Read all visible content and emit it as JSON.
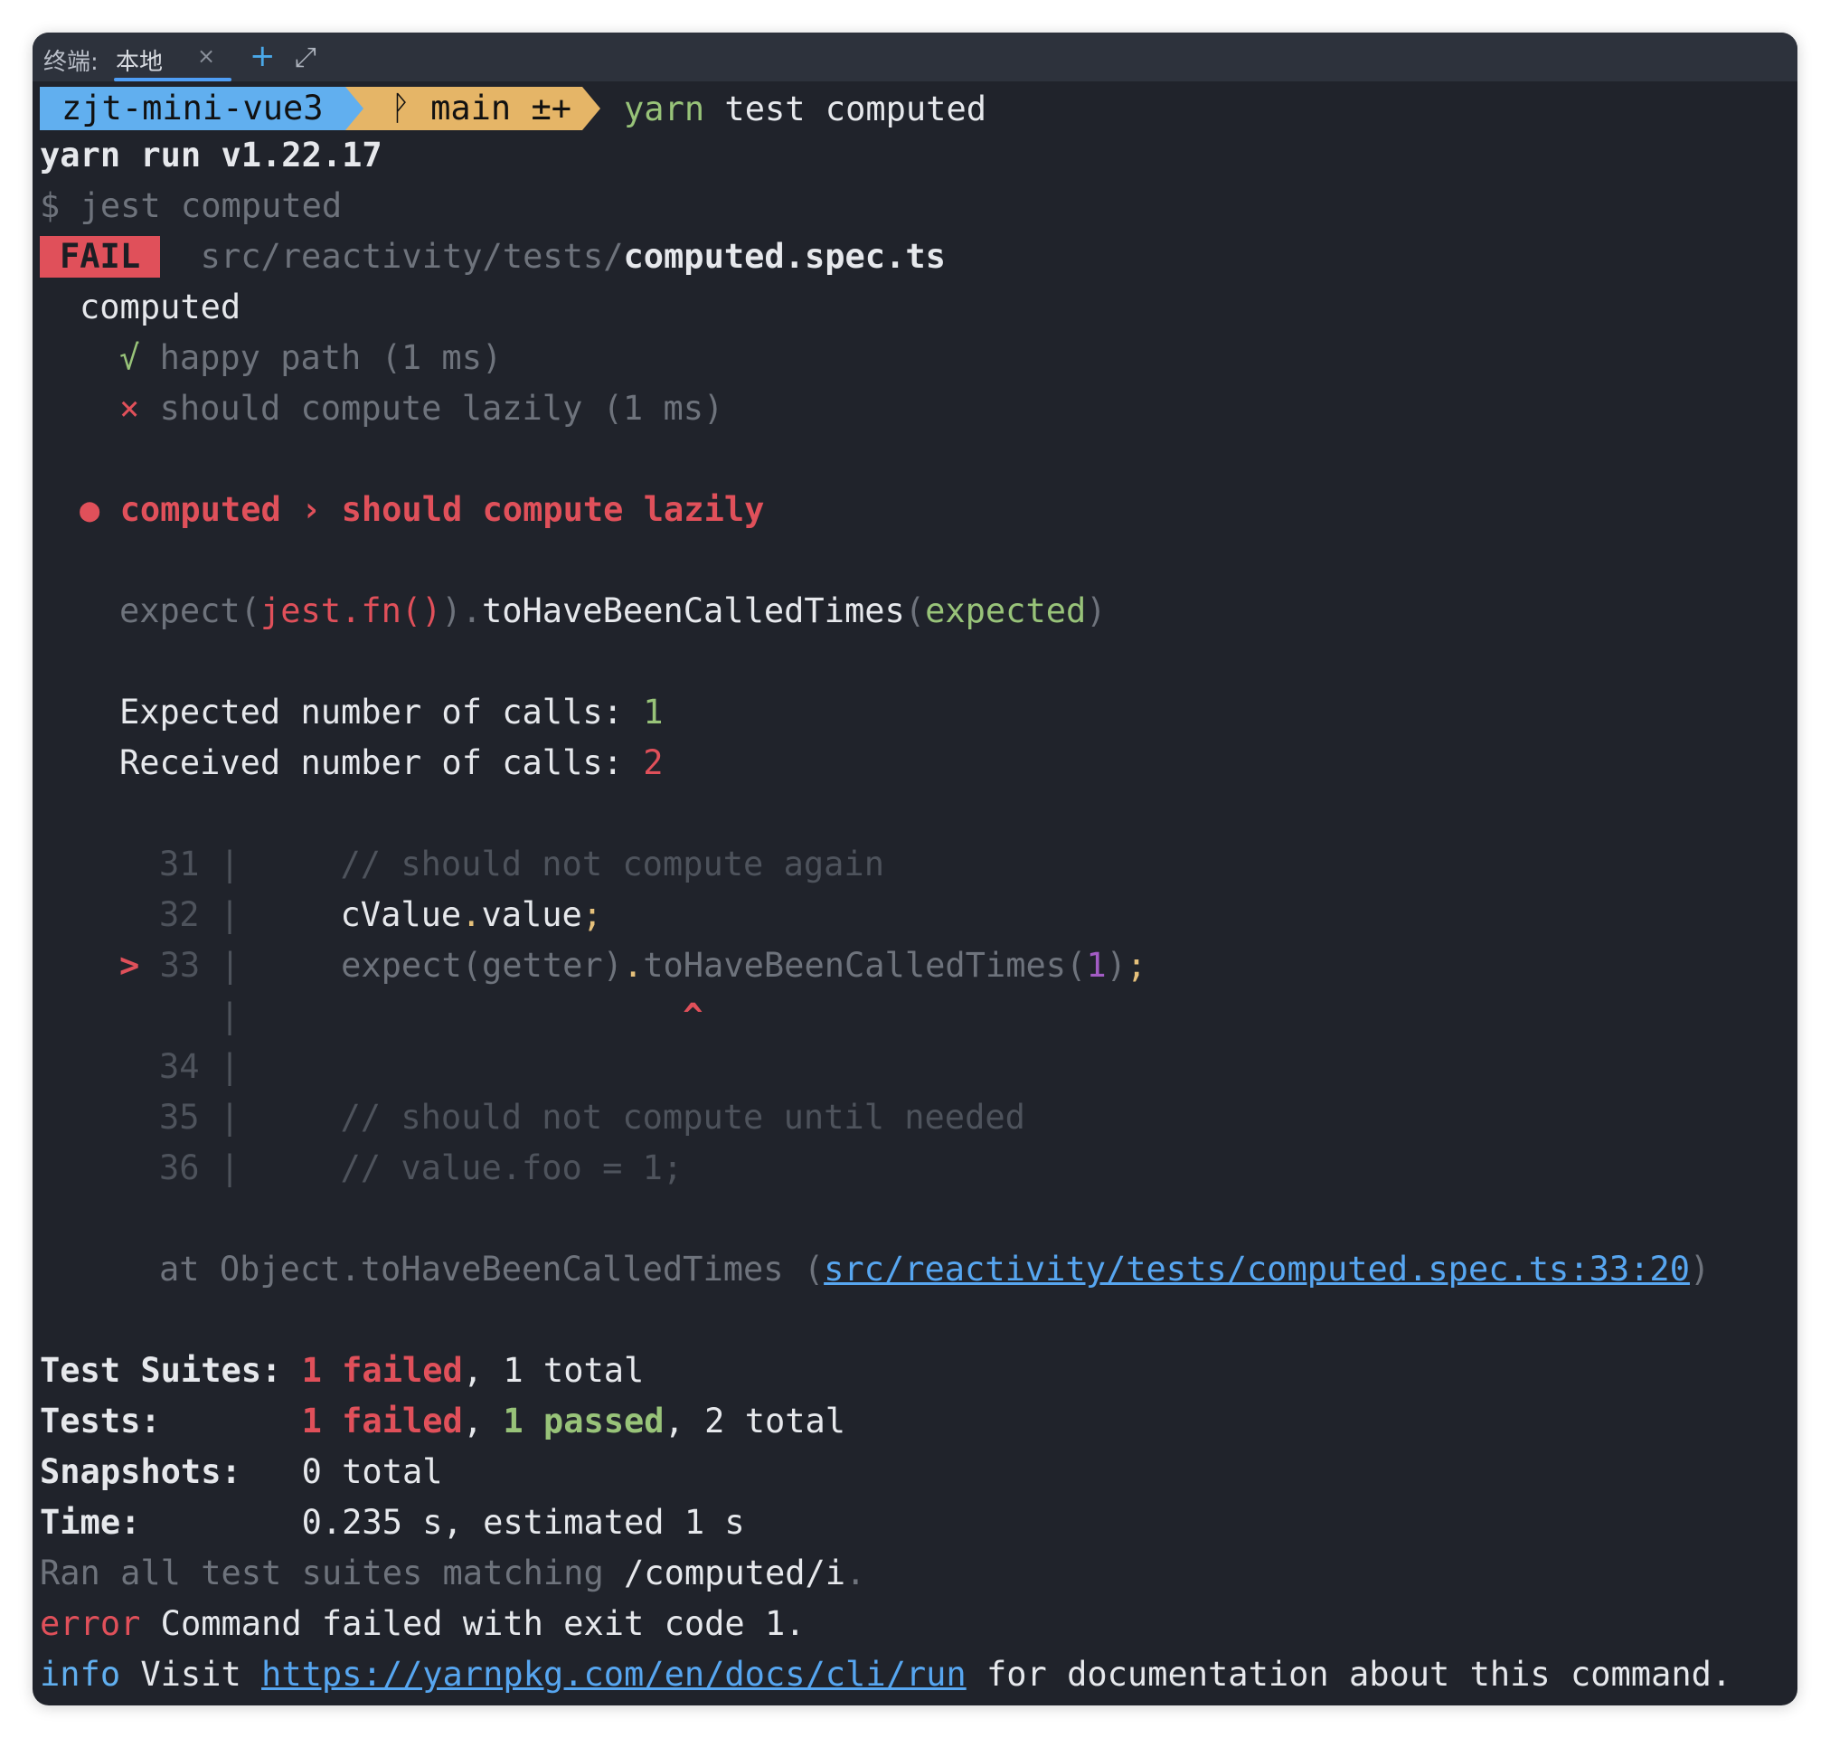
{
  "tabbar": {
    "label": "终端:",
    "tab": "本地",
    "close": "×",
    "plus": "+",
    "expand": "⤢"
  },
  "prompt": {
    "dir": "zjt-mini-vue3",
    "branch_icon": "ᚹ",
    "branch": "main",
    "status": "±+",
    "cmd_yarn": "yarn",
    "cmd_rest": " test computed"
  },
  "lines": {
    "yarn_run": "yarn run v1.22.17",
    "jest_cmd": "$ jest computed",
    "fail_badge": "FAIL",
    "fail_path_dim": "src/reactivity/tests/",
    "fail_path_file": "computed.spec.ts",
    "suite": "computed",
    "test1_icon": "√",
    "test1": "happy path (1 ms)",
    "test2_icon": "×",
    "test2": "should compute lazily (1 ms)",
    "err_bullet": "●",
    "err_title": "computed › should compute lazily",
    "expect_a": "expect(",
    "expect_b": "jest.fn()",
    "expect_c": ").",
    "expect_d": "toHaveBeenCalledTimes",
    "expect_e": "(",
    "expect_f": "expected",
    "expect_g": ")",
    "expected_label": "Expected number of calls: ",
    "expected_val": "1",
    "received_label": "Received number of calls: ",
    "received_val": "2",
    "code": {
      "l31_no": "31",
      "l31": "// should not compute again",
      "l32_no": "32",
      "l32_a": "cValue",
      "l32_b": ".",
      "l32_c": "value",
      "l32_d": ";",
      "l33_marker": ">",
      "l33_no": "33",
      "l33_a": "expect(getter)",
      "l33_b": ".",
      "l33_c": "toHaveBeenCalledTimes(",
      "l33_d": "1",
      "l33_e": ")",
      "l33_f": ";",
      "caret": "^",
      "l34_no": "34",
      "l35_no": "35",
      "l35": "// should not compute until needed",
      "l36_no": "36",
      "l36": "// value.foo = 1;",
      "pipe": "|"
    },
    "at_prefix": "at Object.toHaveBeenCalledTimes (",
    "at_link": "src/reactivity/tests/computed.spec.ts:33:20",
    "at_suffix": ")"
  },
  "summary": {
    "suites_label": "Test Suites: ",
    "suites_failed": "1 failed",
    "suites_total": ", 1 total",
    "tests_label": "Tests:       ",
    "tests_failed": "1 failed",
    "tests_sep": ", ",
    "tests_passed": "1 passed",
    "tests_total": ", 2 total",
    "snap_label": "Snapshots:   ",
    "snap_val": "0 total",
    "time_label": "Time:        ",
    "time_val": "0.235 s, estimated 1 s",
    "ran_a": "Ran all test suites matching ",
    "ran_b": "/computed/i",
    "ran_c": "."
  },
  "footer": {
    "error_word": "error",
    "error_msg": " Command failed with exit code 1.",
    "info_word": "info",
    "info_visit": " Visit ",
    "info_link": "https://yarnpkg.com/en/docs/cli/run",
    "info_rest": " for documentation about this command."
  }
}
